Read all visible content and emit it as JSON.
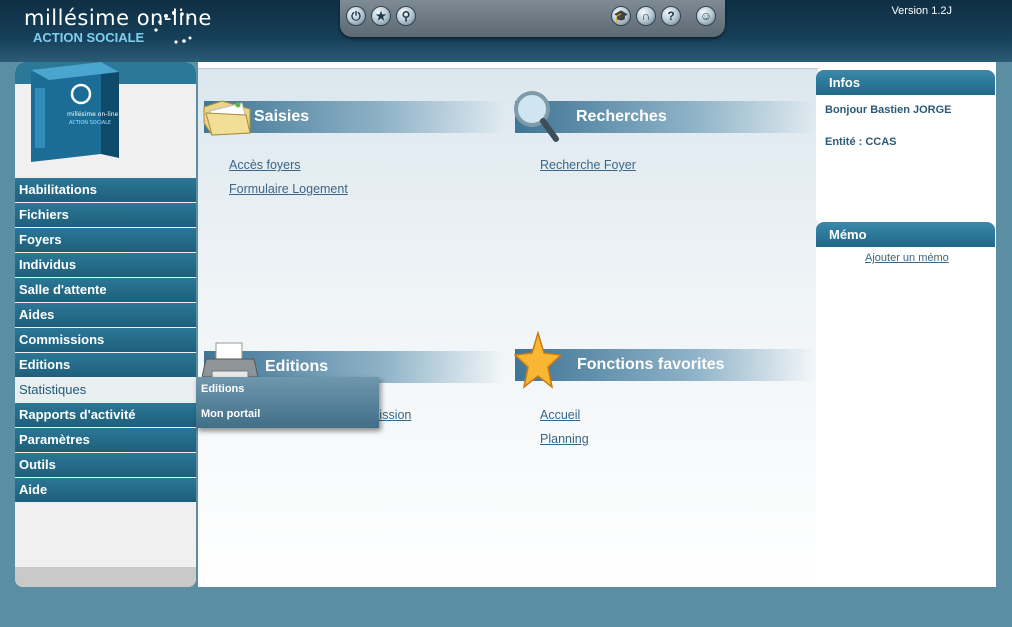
{
  "header": {
    "logo_line1": "millésime on-line",
    "logo_line2": "ACTION SOCIALE",
    "version": "Version 1.2J"
  },
  "toolbar": {
    "icons": [
      "power-icon",
      "star-icon",
      "network-icon",
      "graduation-icon",
      "headset-icon",
      "help-icon",
      "user-icon"
    ]
  },
  "sidebar": {
    "items": [
      {
        "label": "Habilitations"
      },
      {
        "label": "Fichiers"
      },
      {
        "label": "Foyers"
      },
      {
        "label": "Individus"
      },
      {
        "label": "Salle d'attente"
      },
      {
        "label": "Aides"
      },
      {
        "label": "Commissions"
      },
      {
        "label": "Editions"
      },
      {
        "label": "Statistiques"
      },
      {
        "label": "Rapports d'activité"
      },
      {
        "label": "Paramètres"
      },
      {
        "label": "Outils"
      },
      {
        "label": "Aide"
      }
    ],
    "active": "Statistiques"
  },
  "main": {
    "saisies": {
      "title": "Saisies",
      "links": [
        "Accès foyers",
        "Formulaire Logement"
      ]
    },
    "recherches": {
      "title": "Recherches",
      "links": [
        "Recherche Foyer"
      ]
    },
    "editions": {
      "title": "Editions",
      "partial_link": "mission"
    },
    "favoris": {
      "title": "Fonctions favorites",
      "links": [
        "Accueil",
        "Planning"
      ]
    }
  },
  "popup": {
    "items": [
      "Editions",
      "Mon portail"
    ]
  },
  "infos": {
    "title": "Infos",
    "greeting": "Bonjour Bastien JORGE",
    "entity": "Entité : CCAS"
  },
  "memo": {
    "title": "Mémo",
    "add_link": "Ajouter un mémo"
  },
  "colors": {
    "nav_bg": "#2b7896",
    "header_bg": "#163f58",
    "link": "#3a6688",
    "page_bg": "#5b8ea3"
  }
}
